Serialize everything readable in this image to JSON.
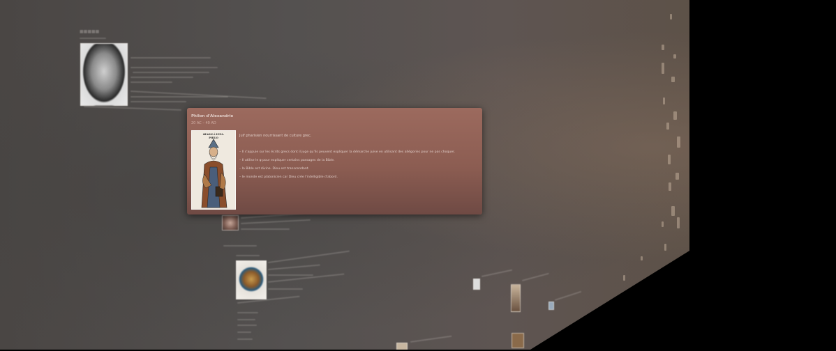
{
  "card": {
    "title": "Philon d'Alexandrie",
    "dates": "20 AC – 40 AD",
    "portrait_caption": "ΦΙΛΩΝ ὁ ΙΟΥΔ.\nPHILO",
    "intro": "Juif pharisien nourrissant de culture grec.",
    "points": [
      "Il s'appuie sur les écrits grecs dont il juge qu'ils peuvent expliquer la démarche juive en utilisant des allégories pour ne pas choquer.",
      "Il utilise le φ pour expliquer certains passages de la Bible.",
      "la Bible est divine. Dieu est transcendant.",
      "le monde est platonicien car Dieu crée l'intelligible d'abord."
    ]
  },
  "colors": {
    "card_top": "#9c6a5e",
    "card_bottom": "#6f4a44",
    "wall": "#544f4c",
    "outside": "#000000"
  },
  "icons": [
    "portrait-thumbnail",
    "bust-portrait",
    "icon-portrait"
  ]
}
